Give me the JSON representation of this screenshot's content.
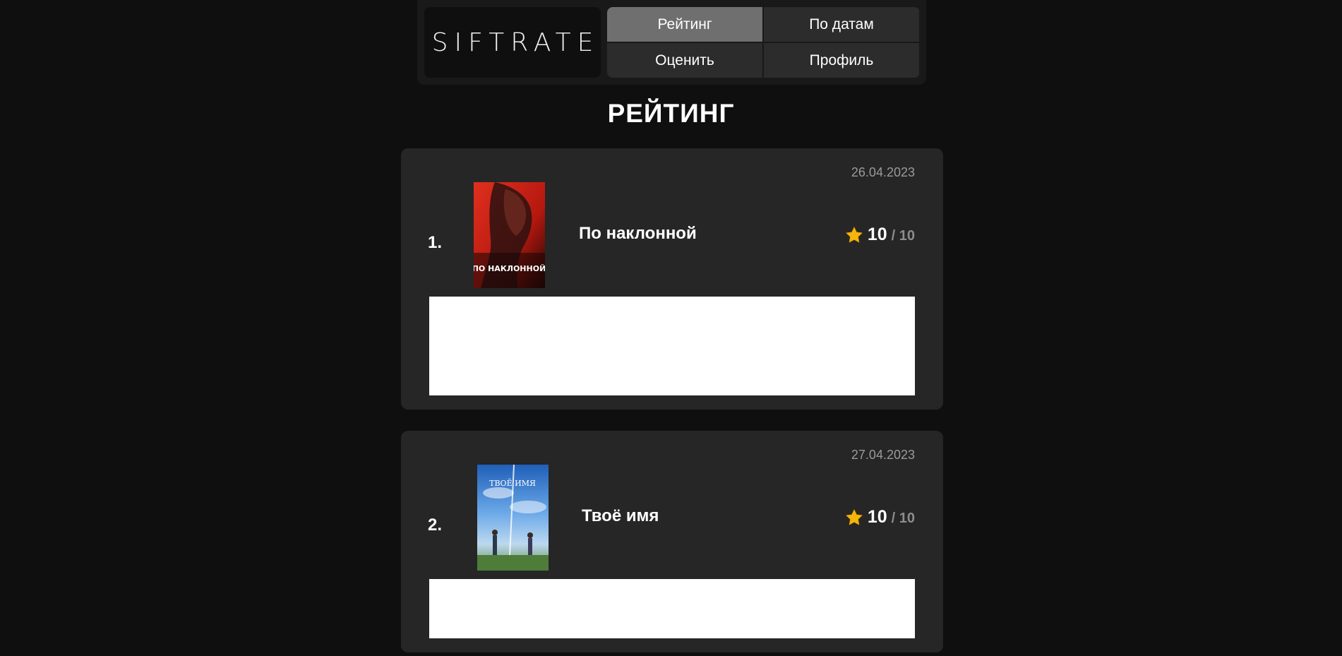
{
  "app": {
    "logo": "SIFTRATE"
  },
  "nav": {
    "items": [
      {
        "label": "Рейтинг",
        "active": true
      },
      {
        "label": "По датам",
        "active": false
      },
      {
        "label": "Оценить",
        "active": false
      },
      {
        "label": "Профиль",
        "active": false
      }
    ]
  },
  "page": {
    "title": "РЕЙТИНГ"
  },
  "ratings": [
    {
      "rank": "1.",
      "date": "26.04.2023",
      "title": "По наклонной",
      "poster_text": "ПО НАКЛОННОЙ",
      "score": "10",
      "score_max": "/ 10",
      "review": ""
    },
    {
      "rank": "2.",
      "date": "27.04.2023",
      "title": "Твоё имя",
      "poster_text": "ТВОЁ ИМЯ",
      "score": "10",
      "score_max": "/ 10",
      "review": ""
    }
  ],
  "colors": {
    "background": "#0f0f0f",
    "card": "#262626",
    "nav_active": "#6f6f6f",
    "nav_inactive": "#2c2c2c",
    "star": "#f5b50a",
    "muted": "#8c8c8c"
  },
  "icons": {
    "rating": "star-icon"
  }
}
